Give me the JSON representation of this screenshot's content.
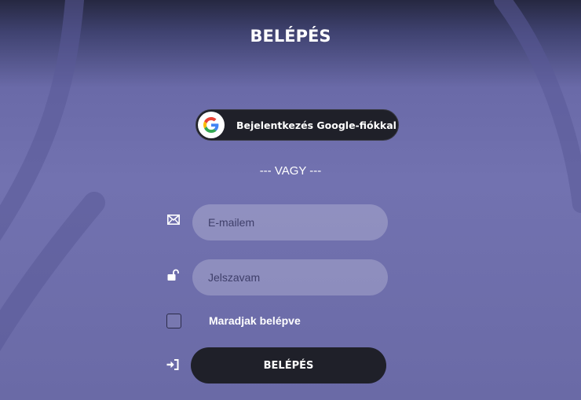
{
  "login": {
    "title": "BELÉPÉS",
    "google_button_label": "Bejelentkezés Google-fiókkal",
    "divider_text": "--- VAGY ---",
    "email_placeholder": "E-mailem",
    "password_placeholder": "Jelszavam",
    "remember_label": "Maradjak belépve",
    "submit_label": "BELÉPÉS"
  },
  "icons": {
    "google": "google-logo-icon",
    "email": "envelope-icon",
    "password": "unlock-icon",
    "submit": "sign-in-icon"
  },
  "colors": {
    "button_dark": "#1f2029",
    "background_purple": "#7272b0"
  }
}
